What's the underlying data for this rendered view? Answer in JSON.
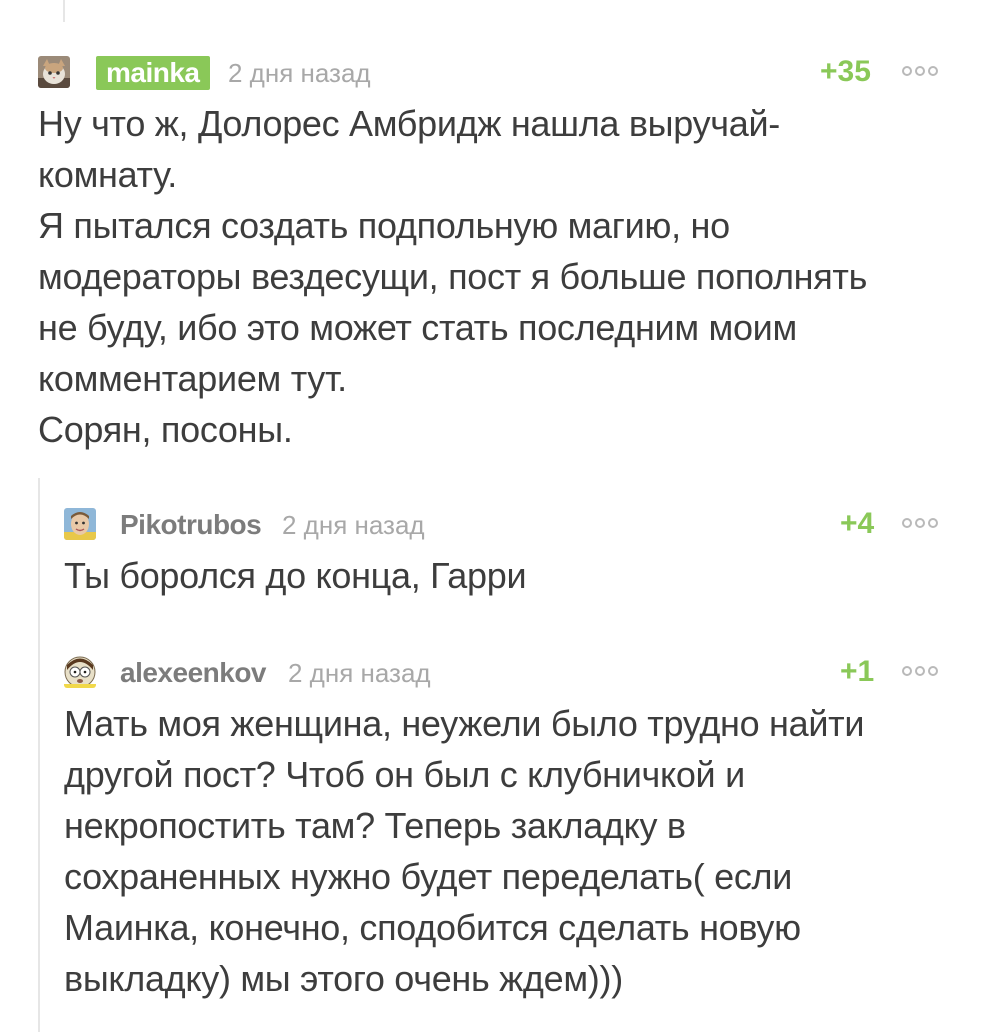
{
  "comments": [
    {
      "author": "mainka",
      "author_highlighted": true,
      "time": "2 дня назад",
      "rating": "+35",
      "avatar_icon": "cat-avatar-icon",
      "text": "Ну что ж, Долорес Амбридж нашла выручай-\nкомнату.\nЯ пытался создать подпольную магию, но\nмодераторы вездесущи, пост я больше пополнять\nне буду, ибо это может стать последним моим\nкомментарием тут.\nСорян, посоны."
    },
    {
      "author": "Pikotrubos",
      "author_highlighted": false,
      "time": "2 дня назад",
      "rating": "+4",
      "avatar_icon": "person-avatar-icon",
      "text": "Ты боролся до конца, Гарри"
    },
    {
      "author": "alexeenkov",
      "author_highlighted": false,
      "time": "2 дня назад",
      "rating": "+1",
      "avatar_icon": "cartoon-avatar-icon",
      "text": "Мать моя женщина, неужели было трудно найти\nдругой пост? Чтоб он был с клубничкой и\nнекропостить там? Теперь закладку в\nсохраненных нужно будет переделать( если\nМаинка, конечно, сподобится сделать новую\nвыкладку) мы этого очень ждем)))"
    }
  ],
  "colors": {
    "accent_green": "#8ac858",
    "meta_gray": "#a8a8a8",
    "thread_line": "#e6e6e6"
  }
}
